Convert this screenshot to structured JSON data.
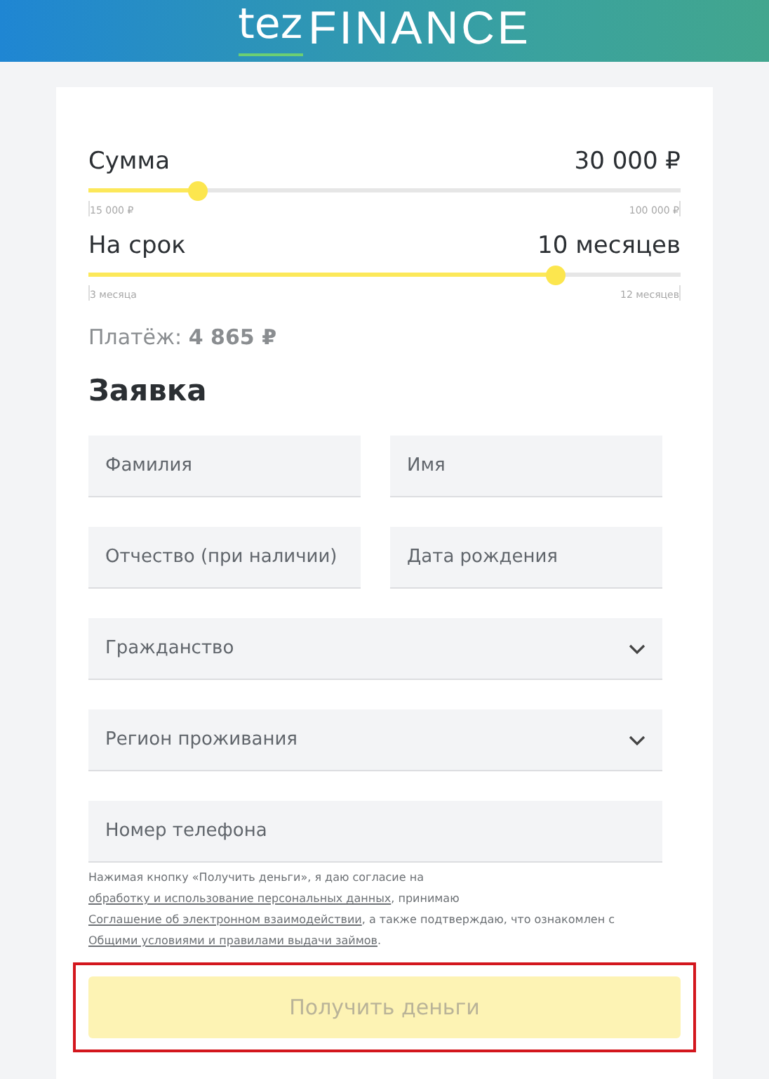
{
  "header": {
    "logo_prefix": "tez",
    "logo_name": "FINANCE"
  },
  "sliders": [
    {
      "label": "Сумма",
      "value": "30 000 ₽",
      "level": 0.186,
      "min_label": "15 000 ₽",
      "max_label": "100 000 ₽"
    },
    {
      "label": "На срок",
      "value": "10 месяцев",
      "level": 0.79,
      "min_label": "3 месяца",
      "max_label": "12 месяцев"
    }
  ],
  "payment": {
    "label": "Платёж:",
    "value": "4 865 ₽"
  },
  "form": {
    "title": "Заявка",
    "rows": [
      [
        {
          "kind": "text",
          "placeholder": "Фамилия"
        },
        {
          "kind": "text",
          "placeholder": "Имя"
        }
      ],
      [
        {
          "kind": "text",
          "placeholder": "Отчество (при наличии)"
        },
        {
          "kind": "text",
          "placeholder": "Дата рождения"
        }
      ],
      [
        {
          "kind": "select",
          "placeholder": "Гражданство"
        }
      ],
      [
        {
          "kind": "select",
          "placeholder": "Регион проживания"
        }
      ],
      [
        {
          "kind": "text",
          "placeholder": "Номер телефона"
        }
      ]
    ],
    "consent": [
      {
        "text": "Нажимая кнопку «Получить деньги», я даю согласие на ",
        "link": false
      },
      {
        "text": "обработку и использование персональных данных",
        "link": true
      },
      {
        "text": ", принимаю ",
        "link": false
      },
      {
        "text": "Соглашение об электронном взаимодействии",
        "link": true
      },
      {
        "text": ", а также подтверждаю, что ознакомлен с ",
        "link": false
      },
      {
        "text": "Общими условиями и правилами выдачи займов",
        "link": true
      },
      {
        "text": ".",
        "link": false
      }
    ],
    "submit": {
      "label": "Получить деньги",
      "disabled": true,
      "highlighted": true
    }
  }
}
